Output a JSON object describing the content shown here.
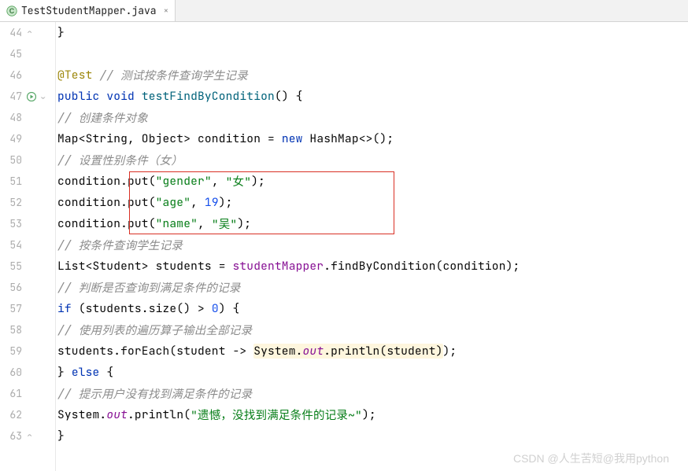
{
  "tab": {
    "filename": "TestStudentMapper.java",
    "close": "×"
  },
  "gutter": {
    "lines": [
      "44",
      "45",
      "46",
      "47",
      "48",
      "49",
      "50",
      "51",
      "52",
      "53",
      "54",
      "55",
      "56",
      "57",
      "58",
      "59",
      "60",
      "61",
      "62",
      "63"
    ]
  },
  "code": {
    "l44": {
      "brace": "}"
    },
    "l46": {
      "anno": "@Test",
      "comment": " // 测试按条件查询学生记录"
    },
    "l47": {
      "kw1": "public ",
      "kw2": "void ",
      "method": "testFindByCondition",
      "rest": "() {"
    },
    "l48": {
      "comment": "// 创建条件对象"
    },
    "l49": {
      "p1": "Map<String, Object> condition = ",
      "kw": "new ",
      "p2": "HashMap<>();"
    },
    "l50": {
      "comment": "// 设置性别条件（女）"
    },
    "l51": {
      "p1": "condition.put(",
      "s1": "\"gender\"",
      "p2": ", ",
      "s2": "\"女\"",
      "p3": ");"
    },
    "l52": {
      "p1": "condition.put(",
      "s1": "\"age\"",
      "p2": ", ",
      "n1": "19",
      "p3": ");"
    },
    "l53": {
      "p1": "condition.put(",
      "s1": "\"name\"",
      "p2": ", ",
      "s2": "\"吴\"",
      "p3": ");"
    },
    "l54": {
      "comment": "// 按条件查询学生记录"
    },
    "l55": {
      "p1": "List<Student> students = ",
      "field": "studentMapper",
      "p2": ".findByCondition(condition);"
    },
    "l56": {
      "comment": "// 判断是否查询到满足条件的记录"
    },
    "l57": {
      "kw": "if ",
      "p1": "(students.size() > ",
      "n1": "0",
      "p2": ") {"
    },
    "l58": {
      "comment": "// 使用列表的遍历算子输出全部记录"
    },
    "l59": {
      "p1": "students.forEach(student -> ",
      "hl1": "System.",
      "hl2": "out",
      "hl3": ".println(student)",
      "p2": ");"
    },
    "l60": {
      "p1": "} ",
      "kw": "else ",
      "p2": "{"
    },
    "l61": {
      "comment": "// 提示用户没有找到满足条件的记录"
    },
    "l62": {
      "p1": "System.",
      "field": "out",
      "p2": ".println(",
      "s1": "\"遗憾，没找到满足条件的记录~\"",
      "p3": ");"
    },
    "l63": {
      "brace": "}"
    }
  },
  "watermark": "CSDN @人生苦短@我用python"
}
